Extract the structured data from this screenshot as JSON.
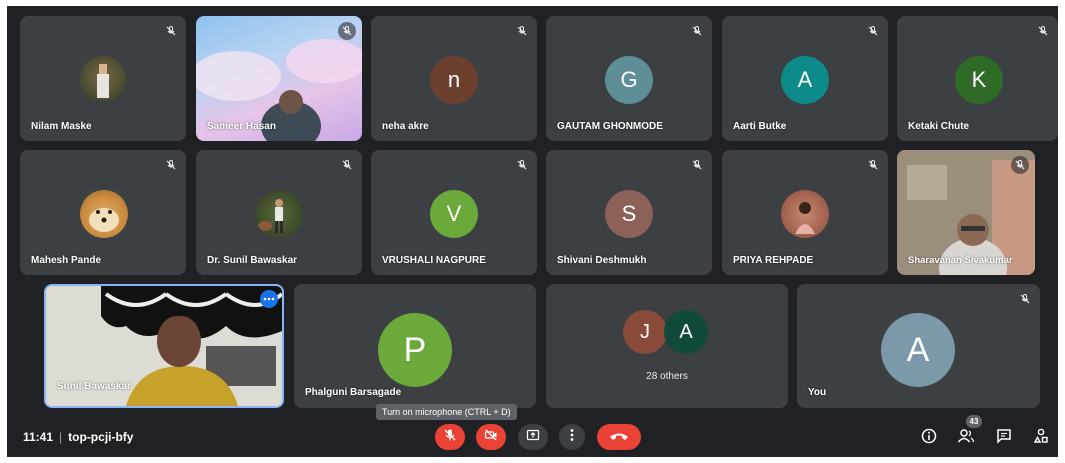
{
  "participants": [
    {
      "name": "Nilam Maske"
    },
    {
      "name": "Sameer Hasan"
    },
    {
      "name": "neha akre",
      "initial": "n",
      "color": "#6d3f2f"
    },
    {
      "name": "GAUTAM GHONMODE",
      "initial": "G",
      "color": "#5e8e96"
    },
    {
      "name": "Aarti Butke",
      "initial": "A",
      "color": "#0d8a8a"
    },
    {
      "name": "Ketaki Chute",
      "initial": "K",
      "color": "#2e6b27"
    },
    {
      "name": "Mahesh Pande"
    },
    {
      "name": "Dr. Sunil Bawaskar"
    },
    {
      "name": "VRUSHALI NAGPURE",
      "initial": "V",
      "color": "#6aa93a"
    },
    {
      "name": "Shivani Deshmukh",
      "initial": "S",
      "color": "#8d6058"
    },
    {
      "name": "PRIYA REHPADE"
    },
    {
      "name": "Sharavanan Sivakumar"
    },
    {
      "name": "Sunil Bawaskar"
    },
    {
      "name": "Phalguni Barsagade",
      "initial": "P",
      "color": "#6aa93a"
    },
    {
      "name": "You",
      "initial": "A",
      "color": "#7b99a8"
    }
  ],
  "others": {
    "label": "28 others",
    "initials": [
      "J",
      "A"
    ],
    "colors": [
      "#8a4a3a",
      "#0f4a3c"
    ]
  },
  "meeting": {
    "time": "11:41",
    "separator": "|",
    "code": "top-pcji-bfy"
  },
  "tooltip": "Turn on microphone (CTRL + D)",
  "people_count": "43",
  "icons": [
    "mic-off-icon",
    "camera-off-icon",
    "present-screen-icon",
    "more-options-icon",
    "end-call-icon",
    "info-icon",
    "people-icon",
    "chat-icon",
    "activities-icon"
  ]
}
